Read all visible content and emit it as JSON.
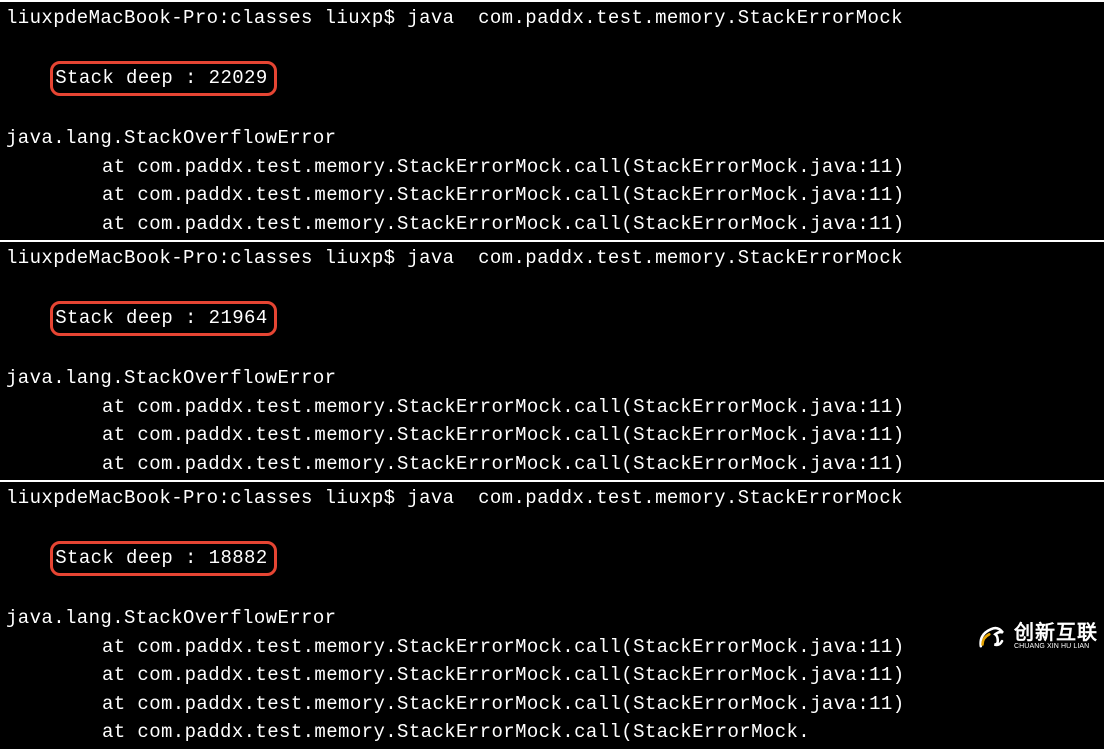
{
  "blocks": [
    {
      "prompt": "liuxpdeMacBook-Pro:classes liuxp$ java  com.paddx.test.memory.StackErrorMock",
      "stack_deep": "Stack deep : 22029",
      "error": "java.lang.StackOverflowError",
      "traces": [
        "at com.paddx.test.memory.StackErrorMock.call(StackErrorMock.java:11)",
        "at com.paddx.test.memory.StackErrorMock.call(StackErrorMock.java:11)",
        "at com.paddx.test.memory.StackErrorMock.call(StackErrorMock.java:11)"
      ]
    },
    {
      "prompt": "liuxpdeMacBook-Pro:classes liuxp$ java  com.paddx.test.memory.StackErrorMock",
      "stack_deep": "Stack deep : 21964",
      "error": "java.lang.StackOverflowError",
      "traces": [
        "at com.paddx.test.memory.StackErrorMock.call(StackErrorMock.java:11)",
        "at com.paddx.test.memory.StackErrorMock.call(StackErrorMock.java:11)",
        "at com.paddx.test.memory.StackErrorMock.call(StackErrorMock.java:11)"
      ]
    },
    {
      "prompt": "liuxpdeMacBook-Pro:classes liuxp$ java  com.paddx.test.memory.StackErrorMock",
      "stack_deep": "Stack deep : 18882",
      "error": "java.lang.StackOverflowError",
      "traces": [
        "at com.paddx.test.memory.StackErrorMock.call(StackErrorMock.java:11)",
        "at com.paddx.test.memory.StackErrorMock.call(StackErrorMock.java:11)",
        "at com.paddx.test.memory.StackErrorMock.call(StackErrorMock.java:11)",
        "at com.paddx.test.memory.StackErrorMock.call(StackErrorMock."
      ]
    }
  ],
  "watermark": {
    "cn": "创新互联",
    "en": "CHUANG XIN HU LIAN"
  }
}
